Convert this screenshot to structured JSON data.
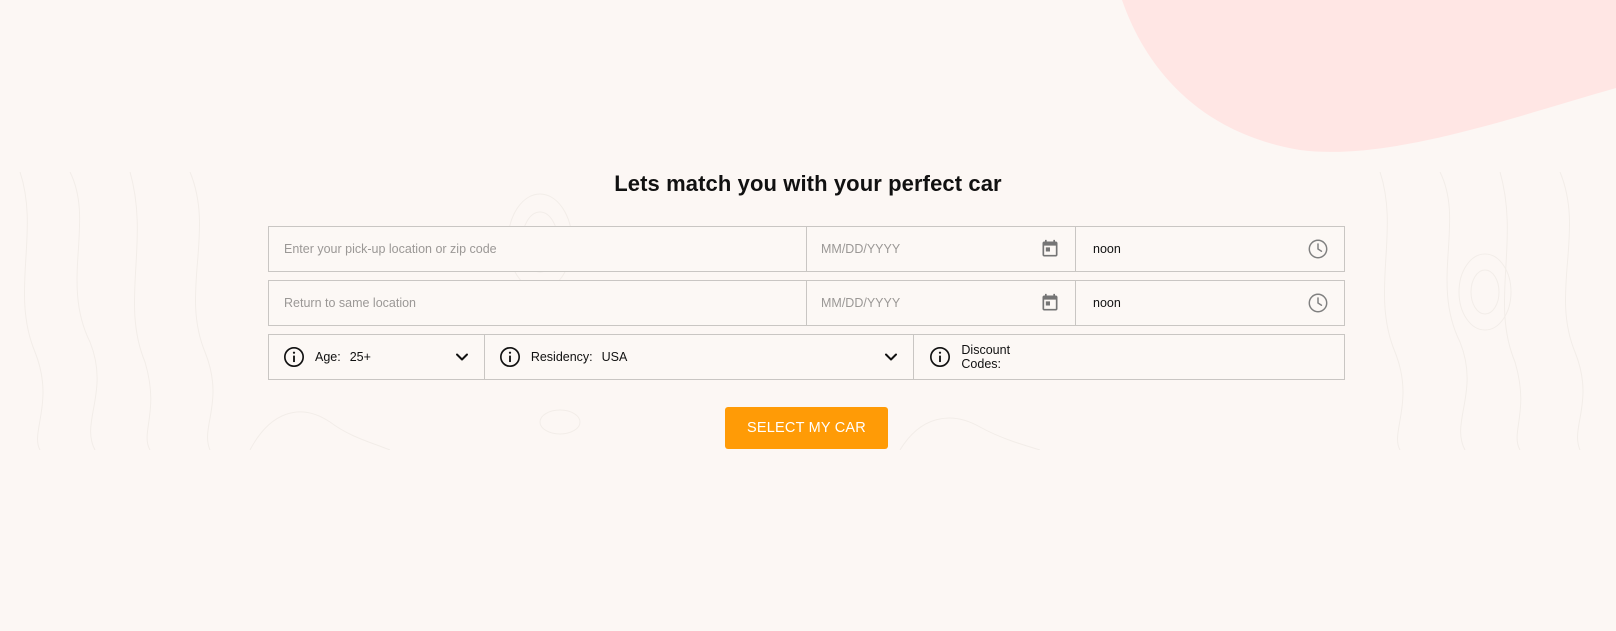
{
  "page": {
    "heading": "Lets match you with your perfect car"
  },
  "pickup": {
    "location_placeholder": "Enter your pick-up location or zip code",
    "date_placeholder": "MM/DD/YYYY",
    "time_value": "noon"
  },
  "return": {
    "location_placeholder": "Return to same location",
    "date_placeholder": "MM/DD/YYYY",
    "time_value": "noon"
  },
  "options": {
    "age_label": "Age:",
    "age_value": "25+",
    "residency_label": "Residency:",
    "residency_value": "USA",
    "discount_label": "Discount Codes:"
  },
  "actions": {
    "submit_label": "SELECT MY CAR"
  },
  "icons": {
    "calendar": "calendar-icon",
    "clock": "clock-icon",
    "info": "info-icon",
    "chevron": "chevron-down-icon"
  },
  "colors": {
    "background": "#fcf7f4",
    "accent": "#ff9b06",
    "blob": "#ffe6e4",
    "border": "#c9c6c3"
  }
}
